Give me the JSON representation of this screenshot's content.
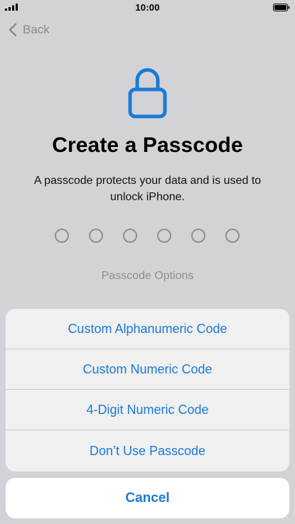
{
  "status_bar": {
    "time": "10:00",
    "signal_icon": "cellular-signal-icon",
    "battery_icon": "battery-icon"
  },
  "nav": {
    "back_label": "Back",
    "back_icon": "chevron-left-icon"
  },
  "header": {
    "icon": "lock-icon",
    "title": "Create a Passcode",
    "subtitle": "A passcode protects your data and is used to unlock iPhone."
  },
  "passcode": {
    "digit_count": 6,
    "entered_count": 0,
    "options_label": "Passcode Options"
  },
  "action_sheet": {
    "items": [
      {
        "label": "Custom Alphanumeric Code"
      },
      {
        "label": "Custom Numeric Code"
      },
      {
        "label": "4-Digit Numeric Code"
      },
      {
        "label": "Don’t Use Passcode"
      }
    ],
    "cancel_label": "Cancel"
  },
  "colors": {
    "accent": "#1a7ad4",
    "background": "#d3d3d7",
    "secondary_text": "#8e8e93"
  }
}
